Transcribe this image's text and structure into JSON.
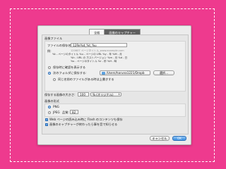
{
  "tabs": [
    {
      "label": "全般"
    },
    {
      "label": "画像のキャプチャー"
    }
  ],
  "image_file": {
    "section_label": "画像ファイル",
    "filename_label": "ファイルの保存名:",
    "filename_value": "12Re%d_%t_%u",
    "example_label": "例:",
    "example_lines": [
      "120607 ページタイトル_www.example.com",
      "%t - ページのタイトル    %u - ページの URL    %y - 年    %M - 月",
      "%h - URL の ホストバージョン    %m - 月    %d - 日",
      "%s - ページのタイトル    %r - 秒    %H - 時"
    ]
  },
  "save_options": {
    "ask_label": "保存時に確認を表示する",
    "folder_label": "次のフォルダに保存する:",
    "folder_path": "/Users/haruna1221/Dropb",
    "choose_button": "選択...",
    "overwrite_label": "同じ名前のファイルがある時は上書きする"
  },
  "scale": {
    "label": "保存する画像の大きさ:",
    "value": "100",
    "unit_option": "% (オリジナル)"
  },
  "format": {
    "section_label": "画像の形式",
    "png_label": "PNG",
    "jpeg_label": "JPEG",
    "quality_label": "品質:",
    "quality_value": "82"
  },
  "options": {
    "flash_label": "Web ページの読み込み時に Flash のコンテンツも保存",
    "notify_label": "画像のキャプチャーが終わったら事を音で知らせる"
  },
  "buttons": {
    "cancel": "キャンセル",
    "ok": "OK"
  },
  "state": {
    "selected_tab": "画像のキャプチャー",
    "save_mode": "folder",
    "format": "PNG",
    "flash_checked": true,
    "notify_checked": true
  }
}
